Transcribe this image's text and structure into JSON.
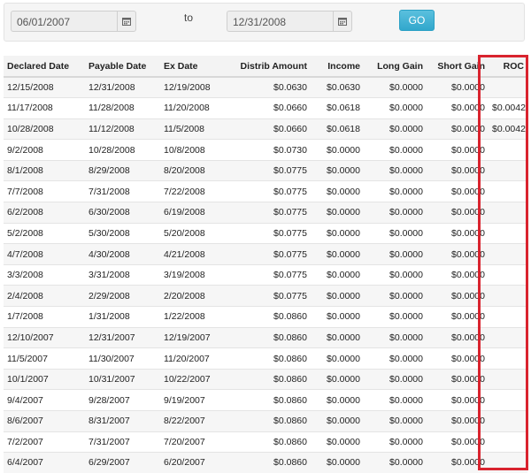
{
  "filter": {
    "start_date": "06/01/2007",
    "to_label": "to",
    "end_date": "12/31/2008",
    "go_label": "GO"
  },
  "table": {
    "headers": [
      "Declared Date",
      "Payable Date",
      "Ex Date",
      "Distrib Amount",
      "Income",
      "Long Gain",
      "Short Gain",
      "ROC"
    ],
    "rows": [
      [
        "12/15/2008",
        "12/31/2008",
        "12/19/2008",
        "$0.0630",
        "$0.0630",
        "$0.0000",
        "$0.0000",
        ""
      ],
      [
        "11/17/2008",
        "11/28/2008",
        "11/20/2008",
        "$0.0660",
        "$0.0618",
        "$0.0000",
        "$0.0000",
        "$0.0042"
      ],
      [
        "10/28/2008",
        "11/12/2008",
        "11/5/2008",
        "$0.0660",
        "$0.0618",
        "$0.0000",
        "$0.0000",
        "$0.0042"
      ],
      [
        "9/2/2008",
        "10/28/2008",
        "10/8/2008",
        "$0.0730",
        "$0.0000",
        "$0.0000",
        "$0.0000",
        ""
      ],
      [
        "8/1/2008",
        "8/29/2008",
        "8/20/2008",
        "$0.0775",
        "$0.0000",
        "$0.0000",
        "$0.0000",
        ""
      ],
      [
        "7/7/2008",
        "7/31/2008",
        "7/22/2008",
        "$0.0775",
        "$0.0000",
        "$0.0000",
        "$0.0000",
        ""
      ],
      [
        "6/2/2008",
        "6/30/2008",
        "6/19/2008",
        "$0.0775",
        "$0.0000",
        "$0.0000",
        "$0.0000",
        ""
      ],
      [
        "5/2/2008",
        "5/30/2008",
        "5/20/2008",
        "$0.0775",
        "$0.0000",
        "$0.0000",
        "$0.0000",
        ""
      ],
      [
        "4/7/2008",
        "4/30/2008",
        "4/21/2008",
        "$0.0775",
        "$0.0000",
        "$0.0000",
        "$0.0000",
        ""
      ],
      [
        "3/3/2008",
        "3/31/2008",
        "3/19/2008",
        "$0.0775",
        "$0.0000",
        "$0.0000",
        "$0.0000",
        ""
      ],
      [
        "2/4/2008",
        "2/29/2008",
        "2/20/2008",
        "$0.0775",
        "$0.0000",
        "$0.0000",
        "$0.0000",
        ""
      ],
      [
        "1/7/2008",
        "1/31/2008",
        "1/22/2008",
        "$0.0860",
        "$0.0000",
        "$0.0000",
        "$0.0000",
        ""
      ],
      [
        "12/10/2007",
        "12/31/2007",
        "12/19/2007",
        "$0.0860",
        "$0.0000",
        "$0.0000",
        "$0.0000",
        ""
      ],
      [
        "11/5/2007",
        "11/30/2007",
        "11/20/2007",
        "$0.0860",
        "$0.0000",
        "$0.0000",
        "$0.0000",
        ""
      ],
      [
        "10/1/2007",
        "10/31/2007",
        "10/22/2007",
        "$0.0860",
        "$0.0000",
        "$0.0000",
        "$0.0000",
        ""
      ],
      [
        "9/4/2007",
        "9/28/2007",
        "9/19/2007",
        "$0.0860",
        "$0.0000",
        "$0.0000",
        "$0.0000",
        ""
      ],
      [
        "8/6/2007",
        "8/31/2007",
        "8/22/2007",
        "$0.0860",
        "$0.0000",
        "$0.0000",
        "$0.0000",
        ""
      ],
      [
        "7/2/2007",
        "7/31/2007",
        "7/20/2007",
        "$0.0860",
        "$0.0000",
        "$0.0000",
        "$0.0000",
        ""
      ],
      [
        "6/4/2007",
        "6/29/2007",
        "6/20/2007",
        "$0.0860",
        "$0.0000",
        "$0.0000",
        "$0.0000",
        ""
      ]
    ]
  },
  "colors": {
    "go_button": "#31a7cc",
    "highlight": "#d9232e"
  },
  "icons": {
    "calendar": "calendar-icon"
  }
}
